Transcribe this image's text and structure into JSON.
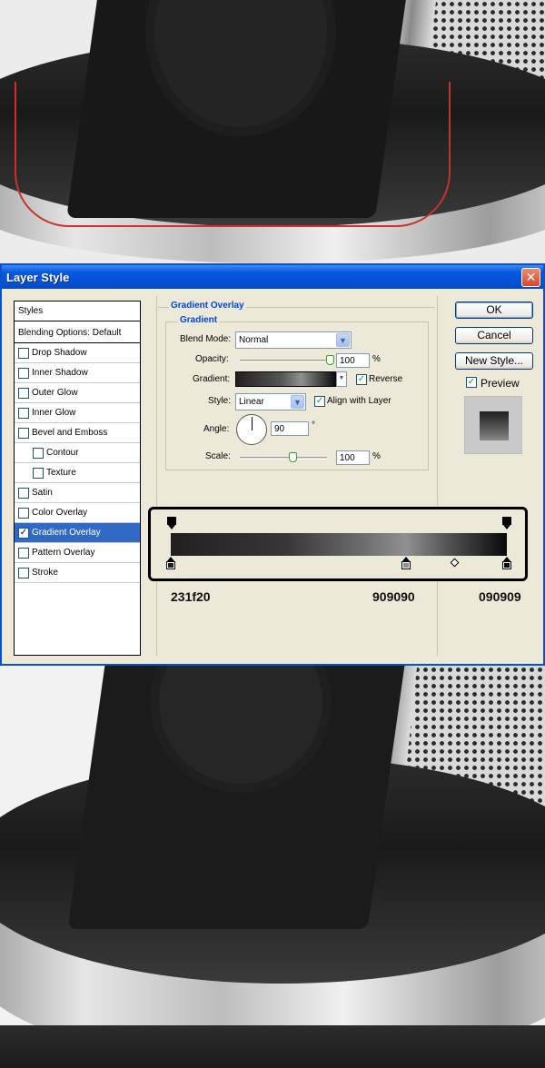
{
  "dialog": {
    "title": "Layer Style",
    "close_glyph": "✕"
  },
  "styles_list": {
    "header": "Styles",
    "blending": "Blending Options: Default",
    "items": [
      {
        "label": "Drop Shadow",
        "checked": false
      },
      {
        "label": "Inner Shadow",
        "checked": false
      },
      {
        "label": "Outer Glow",
        "checked": false
      },
      {
        "label": "Inner Glow",
        "checked": false
      },
      {
        "label": "Bevel and Emboss",
        "checked": false
      },
      {
        "label": "Contour",
        "checked": false
      },
      {
        "label": "Texture",
        "checked": false
      },
      {
        "label": "Satin",
        "checked": false
      },
      {
        "label": "Color Overlay",
        "checked": false
      },
      {
        "label": "Gradient Overlay",
        "checked": true
      },
      {
        "label": "Pattern Overlay",
        "checked": false
      },
      {
        "label": "Stroke",
        "checked": false
      }
    ]
  },
  "gradient_overlay": {
    "section_title": "Gradient Overlay",
    "group_title": "Gradient",
    "blend_mode_label": "Blend Mode:",
    "blend_mode_value": "Normal",
    "opacity_label": "Opacity:",
    "opacity_value": "100",
    "opacity_unit": "%",
    "opacity_level": 1.0,
    "gradient_label": "Gradient:",
    "reverse_label": "Reverse",
    "reverse_checked": true,
    "style_label": "Style:",
    "style_value": "Linear",
    "align_label": "Align with Layer",
    "align_checked": true,
    "angle_label": "Angle:",
    "angle_value": "90",
    "angle_unit": "°",
    "scale_label": "Scale:",
    "scale_value": "100",
    "scale_unit": "%",
    "scale_level": 0.5
  },
  "buttons": {
    "ok": "OK",
    "cancel": "Cancel",
    "new_style": "New Style...",
    "preview_label": "Preview",
    "preview_checked": true
  },
  "gradient_editor": {
    "stops": [
      {
        "label": "231f20",
        "color": "#231f20",
        "location": 0.0
      },
      {
        "label": "909090",
        "color": "#909090",
        "location": 0.7
      },
      {
        "label": "090909",
        "color": "#090909",
        "location": 1.0
      }
    ],
    "check_glyph": "✓"
  },
  "colors": {
    "title_bar": "#0453d6",
    "selected_row": "#316ac5",
    "group_title": "#0046d5",
    "red_stroke": "#c8322c"
  }
}
